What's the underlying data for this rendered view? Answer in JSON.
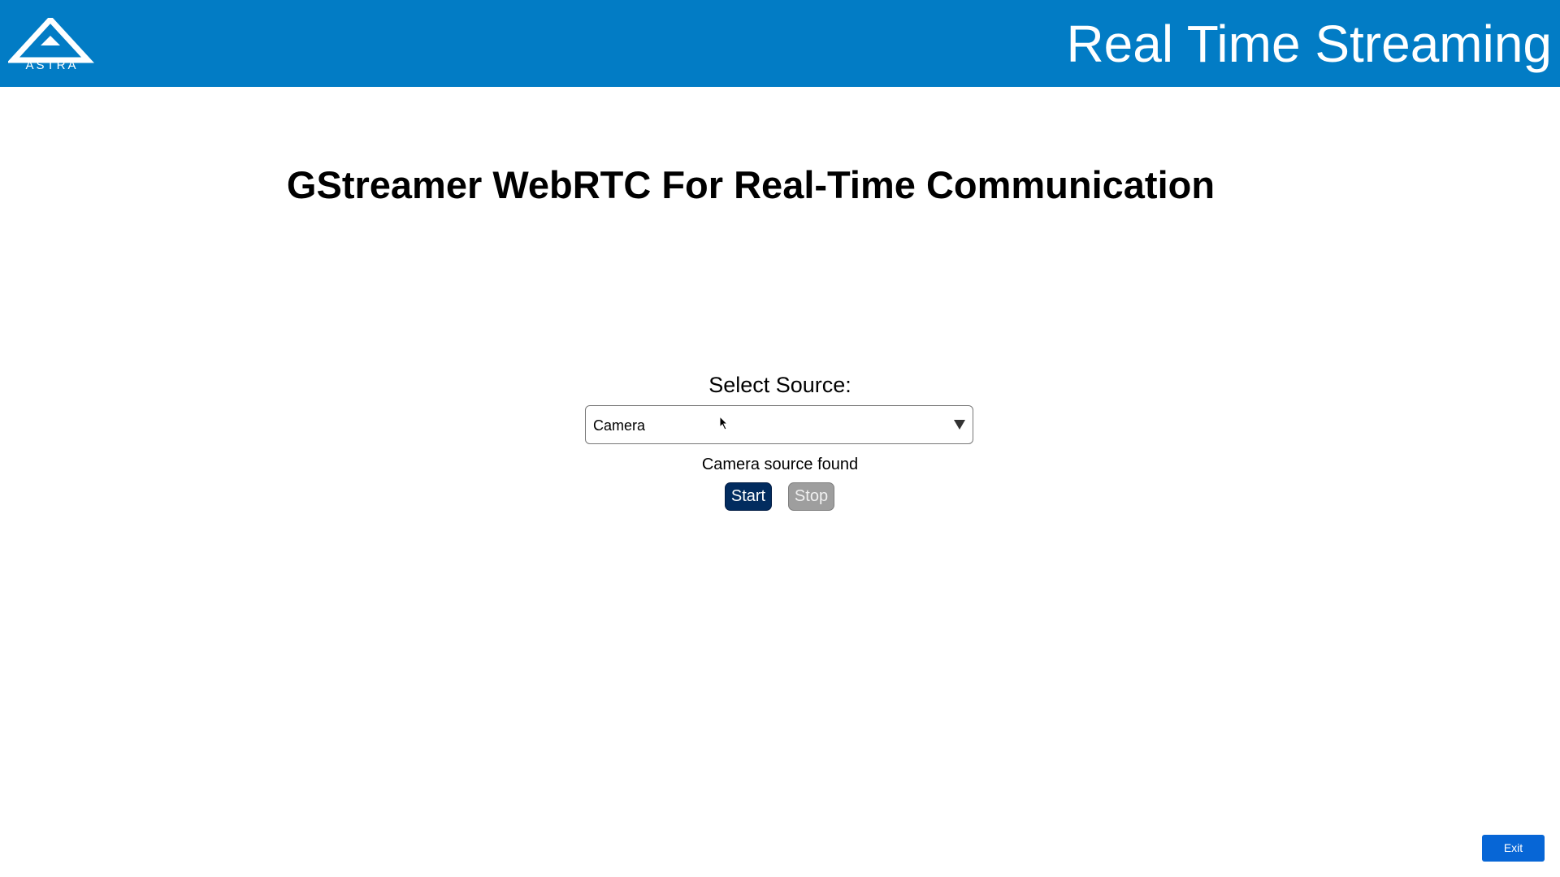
{
  "header": {
    "logo_text": "ASTRA",
    "title": "Real Time Streaming",
    "background_color": "#027cc5"
  },
  "main": {
    "heading": "GStreamer WebRTC For Real-Time Communication",
    "source_label": "Select Source:",
    "source_select": {
      "selected_value": "Camera",
      "arrow_icon": "triangle-down-icon"
    },
    "status": "Camera source found",
    "start_label": "Start",
    "stop_label": "Stop"
  },
  "footer": {
    "exit_label": "Exit"
  },
  "colors": {
    "start_button": "#022c5f",
    "stop_button": "#9e9e9e",
    "exit_button": "#0766d6"
  }
}
